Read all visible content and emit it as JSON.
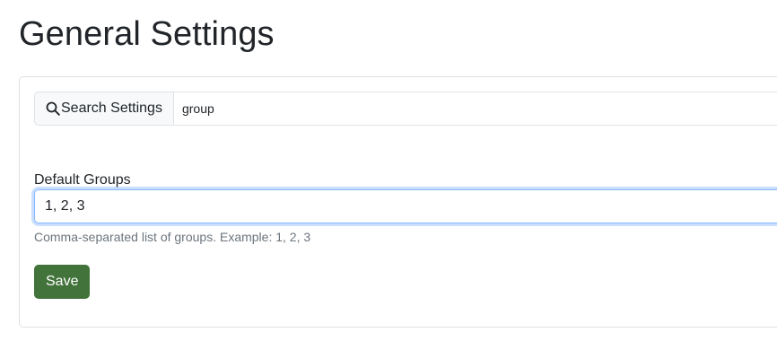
{
  "header": {
    "title": "General Settings"
  },
  "search": {
    "icon": "search-icon",
    "label": "Search Settings",
    "value": "group"
  },
  "default_groups": {
    "label": "Default Groups",
    "value": "1, 2, 3",
    "help": "Comma-separated list of groups. Example: 1, 2, 3"
  },
  "actions": {
    "save_label": "Save"
  },
  "colors": {
    "primary_button": "#42733b",
    "focus_border": "#86b7fe"
  }
}
